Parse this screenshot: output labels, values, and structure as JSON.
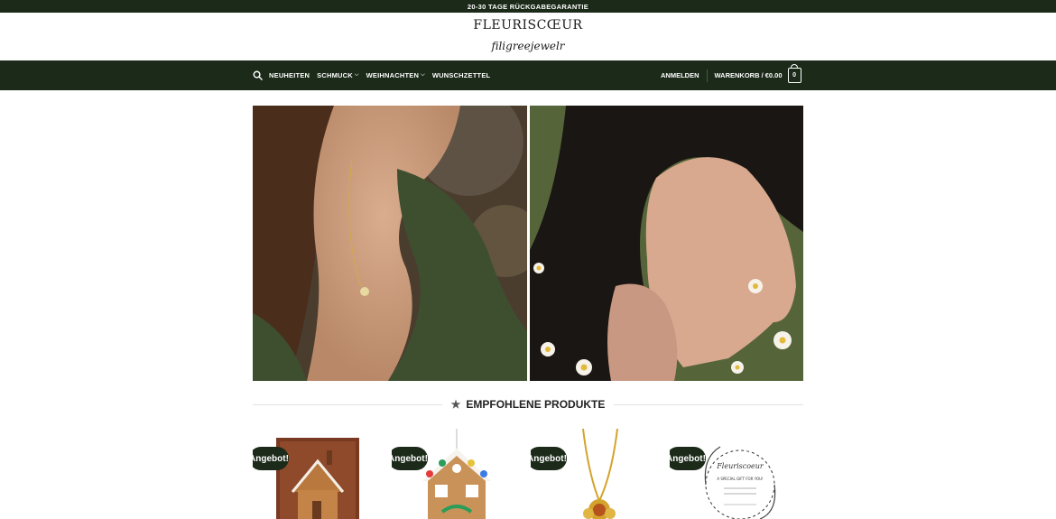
{
  "topbar": {
    "text": "20-30 TAGE RÜCKGABEGARANTIE"
  },
  "brand": {
    "name": "FLEURISCŒUR",
    "tagline": "filigreejewelr"
  },
  "nav": {
    "items": [
      {
        "label": "NEUHEITEN",
        "dropdown": false
      },
      {
        "label": "SCHMUCK",
        "dropdown": true
      },
      {
        "label": "WEIHNACHTEN",
        "dropdown": true
      },
      {
        "label": "WUNSCHZETTEL",
        "dropdown": false
      }
    ],
    "login": "ANMELDEN",
    "cart": "WARENKORB / €0.00",
    "cart_count": "0"
  },
  "section": {
    "title": "EMPFOHLENE PRODUKTE",
    "icon": "star-icon"
  },
  "products": [
    {
      "badge": "Angebot!",
      "image": "gingerbread-house-card"
    },
    {
      "badge": "Angebot!",
      "image": "gingerbread-house-ornament"
    },
    {
      "badge": "Angebot!",
      "image": "gold-amber-pendant"
    },
    {
      "badge": "Angebot!",
      "image": "gift-voucher-card"
    }
  ],
  "colors": {
    "brand_dark": "#1b2a19",
    "white": "#ffffff"
  }
}
